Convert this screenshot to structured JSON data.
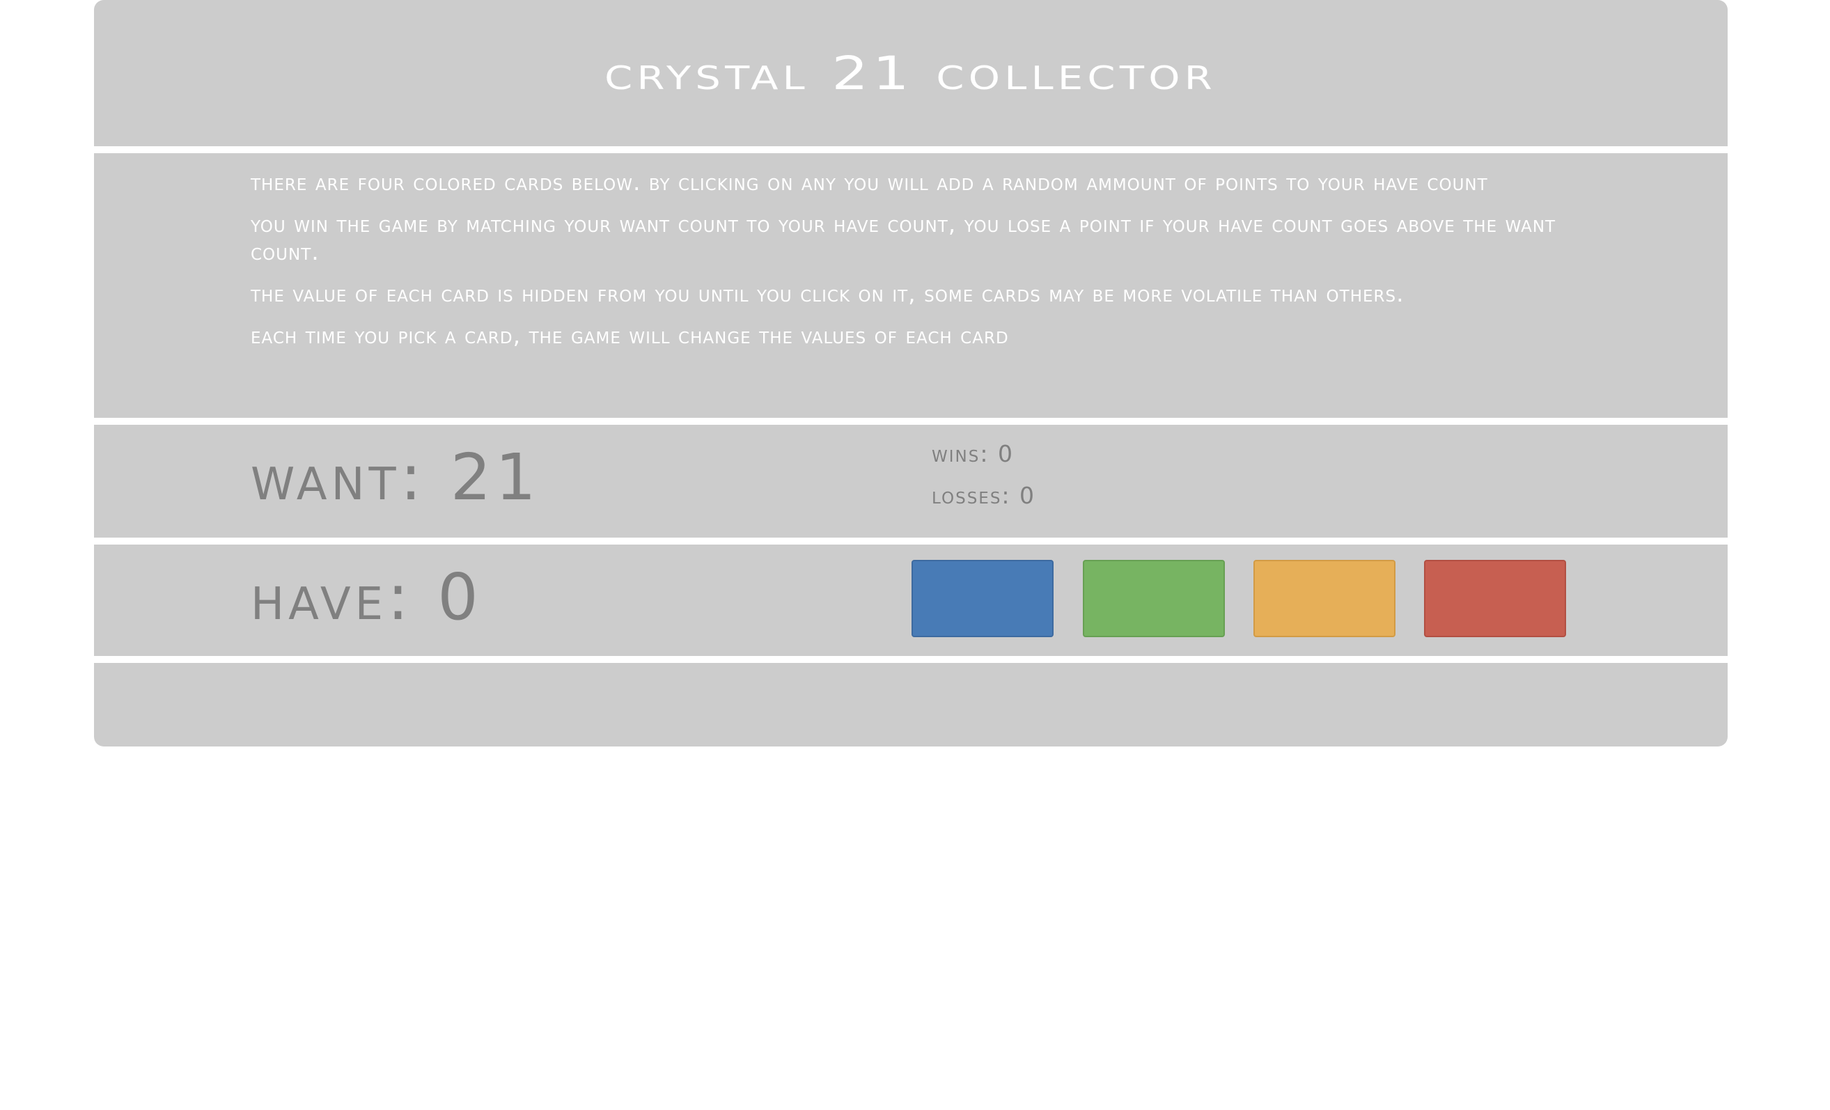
{
  "game": {
    "title": "Crystal 21 Collector"
  },
  "instructions": [
    "There are four colored cards below. By clicking on any you will add a random ammount of points to your have count",
    "You win the game by matching your want count to your have count, you lose a point if your have count goes above the want count.",
    "The value of each card is hidden from you until you click on it, some cards may be more volatile than others.",
    "Each time you pick a card, the game will change the values of each card"
  ],
  "scoreboard": {
    "want_text": "Want: 21",
    "have_text": "Have: 0",
    "wins_text": "Wins: 0",
    "losses_text": "Losses: 0"
  },
  "cards": [
    {
      "name": "blue-card",
      "color": "#487bb6",
      "border": "#3d6aa0"
    },
    {
      "name": "green-card",
      "color": "#77b462",
      "border": "#67a053"
    },
    {
      "name": "orange-card",
      "color": "#e6af58",
      "border": "#d29b45"
    },
    {
      "name": "red-card",
      "color": "#c75f51",
      "border": "#b24f42"
    }
  ],
  "colors": {
    "panel": "#cccccc",
    "title_text": "#ffffff",
    "count_text": "#808080"
  }
}
